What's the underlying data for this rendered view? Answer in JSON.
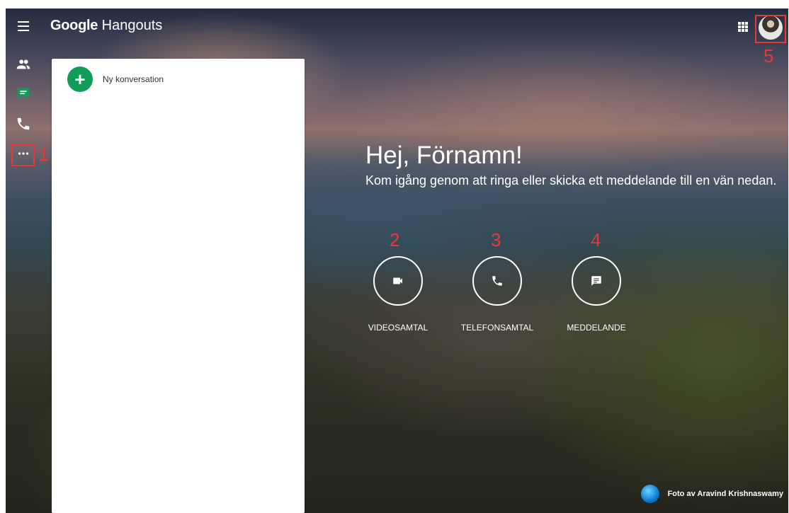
{
  "app": {
    "logo_brand": "Google",
    "logo_product": "Hangouts"
  },
  "header": {
    "menu_icon": "hamburger-menu-icon",
    "apps_icon": "apps-grid-icon",
    "avatar_label": "avatar"
  },
  "sidebar": {
    "items": [
      {
        "name": "contacts",
        "icon": "people-icon",
        "color": "#ffffff"
      },
      {
        "name": "conversations",
        "icon": "chat-icon",
        "color": "#0f9d58"
      },
      {
        "name": "phone-calls",
        "icon": "phone-icon",
        "color": "#ffffff"
      },
      {
        "name": "more",
        "icon": "more-dots-icon",
        "color": "#ffffff"
      }
    ]
  },
  "panel": {
    "new_conversation_label": "Ny konversation"
  },
  "main": {
    "greeting": "Hej, Förnamn!",
    "subtitle": "Kom igång genom att ringa eller skicka ett meddelande till en vän nedan.",
    "actions": [
      {
        "label": "VIDEOSAMTAL",
        "icon": "video-camera-icon"
      },
      {
        "label": "TELEFONSAMTAL",
        "icon": "phone-icon"
      },
      {
        "label": "MEDDELANDE",
        "icon": "message-icon"
      }
    ]
  },
  "annotations": {
    "markers": [
      "1",
      "2",
      "3",
      "4",
      "5"
    ],
    "color": "#e53935"
  },
  "photo_credit": "Foto av Aravind Krishnaswamy",
  "colors": {
    "accent_green": "#0f9d58",
    "panel_bg": "#ffffff"
  }
}
